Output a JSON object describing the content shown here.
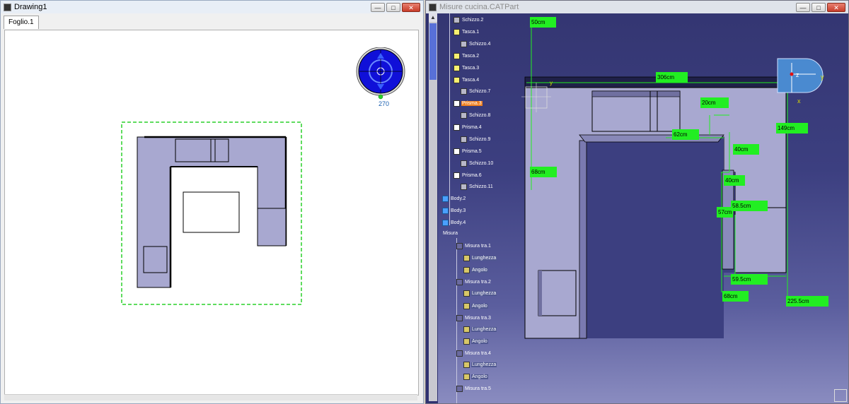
{
  "drawing_window": {
    "title": "Drawing1",
    "tab_label": "Foglio.1",
    "compass_angle": "270"
  },
  "catpart_window": {
    "title": "Misure cucina.CATPart",
    "tree": [
      {
        "label": "Schizzo.2",
        "icon": "sketch-icon"
      },
      {
        "label": "Tasca.1",
        "icon": "pocket-icon"
      },
      {
        "label": "Schizzo.4",
        "icon": "sketch-icon"
      },
      {
        "label": "Tasca.2",
        "icon": "pocket-icon"
      },
      {
        "label": "Tasca.3",
        "icon": "pocket-icon"
      },
      {
        "label": "Tasca.4",
        "icon": "pocket-icon"
      },
      {
        "label": "Schizzo.7",
        "icon": "sketch-icon"
      },
      {
        "label": "Prisma.3",
        "icon": "prism-icon"
      },
      {
        "label": "Schizzo.8",
        "icon": "sketch-icon"
      },
      {
        "label": "Prisma.4",
        "icon": "prism-icon"
      },
      {
        "label": "Schizzo.9",
        "icon": "sketch-icon"
      },
      {
        "label": "Prisma.5",
        "icon": "prism-icon"
      },
      {
        "label": "Schizzo.10",
        "icon": "sketch-icon"
      },
      {
        "label": "Prisma.6",
        "icon": "prism-icon"
      },
      {
        "label": "Schizzo.11",
        "icon": "sketch-icon"
      },
      {
        "label": "Body.2",
        "icon": "body-icon"
      },
      {
        "label": "Body.3",
        "icon": "body-icon"
      },
      {
        "label": "Body.4",
        "icon": "body-icon"
      },
      {
        "label": "Misura",
        "icon": ""
      },
      {
        "label": "Misura tra.1",
        "icon": "measure-icon"
      },
      {
        "label": "Lunghezza",
        "icon": "geometry-icon"
      },
      {
        "label": "Angolo",
        "icon": "geometry-icon"
      },
      {
        "label": "Misura tra.2",
        "icon": "measure-icon"
      },
      {
        "label": "Lunghezza",
        "icon": "geometry-icon"
      },
      {
        "label": "Angolo",
        "icon": "geometry-icon"
      },
      {
        "label": "Misura tra.3",
        "icon": "measure-icon"
      },
      {
        "label": "Lunghezza",
        "icon": "geometry-icon"
      },
      {
        "label": "Angolo",
        "icon": "geometry-icon"
      },
      {
        "label": "Misura tra.4",
        "icon": "measure-icon"
      },
      {
        "label": "Lunghezza",
        "icon": "geometry-icon"
      },
      {
        "label": "Angolo",
        "icon": "geometry-icon"
      },
      {
        "label": "Misura tra.5",
        "icon": "measure-icon"
      }
    ],
    "dimensions": [
      "50cm",
      "306cm",
      "20cm",
      "149cm",
      "62cm",
      "40cm",
      "68cm",
      "40cm",
      "58.5cm",
      "57cm",
      "59.5cm",
      "68cm",
      "225.5cm"
    ],
    "axis_labels": {
      "x": "x",
      "y": "y",
      "z": "z"
    }
  },
  "colors": {
    "dimension_tag": "#22ee22",
    "model_fill": "#a8a8d0",
    "highlight": "#f08020"
  }
}
